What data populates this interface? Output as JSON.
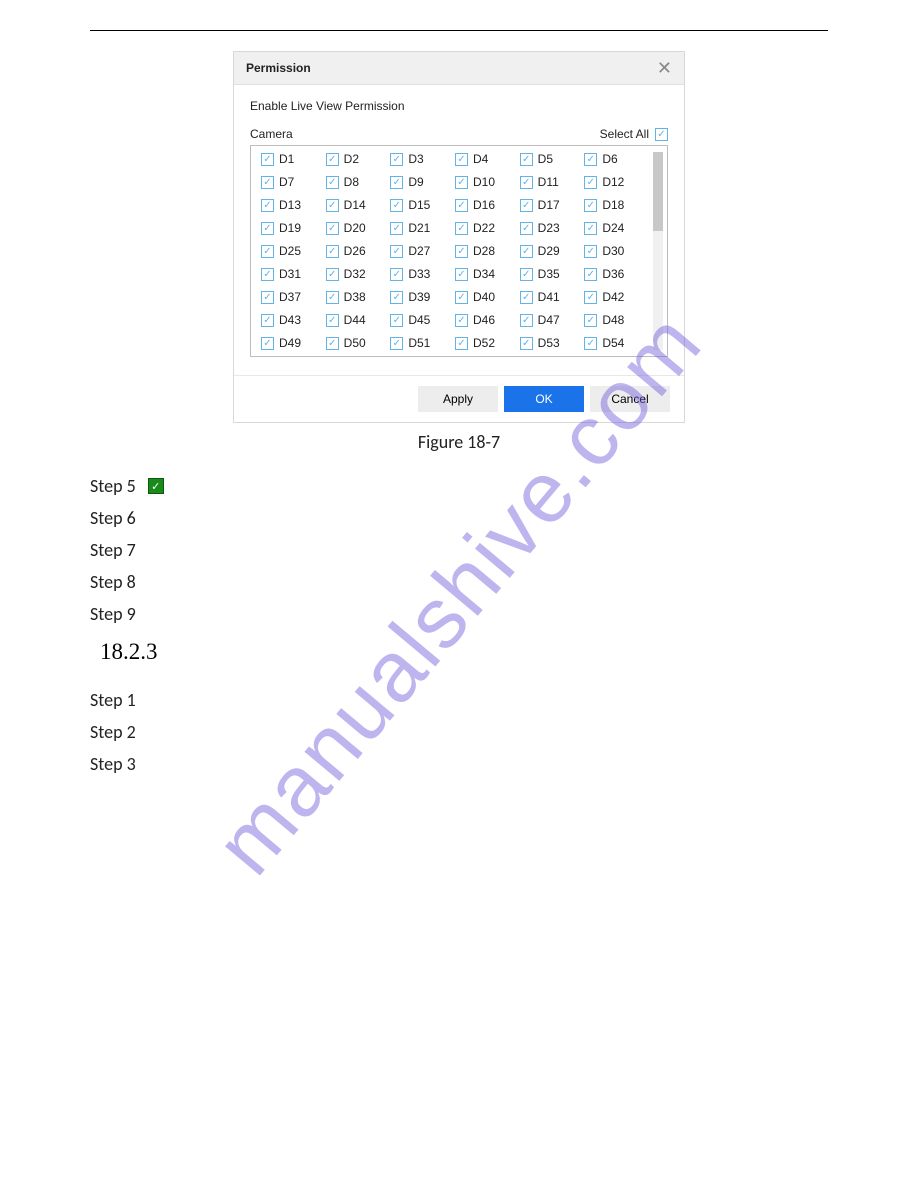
{
  "dialog": {
    "title": "Permission",
    "subtitle": "Enable Live View Permission",
    "cameraLabel": "Camera",
    "selectAllLabel": "Select All",
    "selectAllChecked": true,
    "cameras": [
      {
        "label": "D1",
        "checked": true
      },
      {
        "label": "D2",
        "checked": true
      },
      {
        "label": "D3",
        "checked": true
      },
      {
        "label": "D4",
        "checked": true
      },
      {
        "label": "D5",
        "checked": true
      },
      {
        "label": "D6",
        "checked": true
      },
      {
        "label": "D7",
        "checked": true
      },
      {
        "label": "D8",
        "checked": true
      },
      {
        "label": "D9",
        "checked": true
      },
      {
        "label": "D10",
        "checked": true
      },
      {
        "label": "D11",
        "checked": true
      },
      {
        "label": "D12",
        "checked": true
      },
      {
        "label": "D13",
        "checked": true
      },
      {
        "label": "D14",
        "checked": true
      },
      {
        "label": "D15",
        "checked": true
      },
      {
        "label": "D16",
        "checked": true
      },
      {
        "label": "D17",
        "checked": true
      },
      {
        "label": "D18",
        "checked": true
      },
      {
        "label": "D19",
        "checked": true
      },
      {
        "label": "D20",
        "checked": true
      },
      {
        "label": "D21",
        "checked": true
      },
      {
        "label": "D22",
        "checked": true
      },
      {
        "label": "D23",
        "checked": true
      },
      {
        "label": "D24",
        "checked": true
      },
      {
        "label": "D25",
        "checked": true
      },
      {
        "label": "D26",
        "checked": true
      },
      {
        "label": "D27",
        "checked": true
      },
      {
        "label": "D28",
        "checked": true
      },
      {
        "label": "D29",
        "checked": true
      },
      {
        "label": "D30",
        "checked": true
      },
      {
        "label": "D31",
        "checked": true
      },
      {
        "label": "D32",
        "checked": true
      },
      {
        "label": "D33",
        "checked": true
      },
      {
        "label": "D34",
        "checked": true
      },
      {
        "label": "D35",
        "checked": true
      },
      {
        "label": "D36",
        "checked": true
      },
      {
        "label": "D37",
        "checked": true
      },
      {
        "label": "D38",
        "checked": true
      },
      {
        "label": "D39",
        "checked": true
      },
      {
        "label": "D40",
        "checked": true
      },
      {
        "label": "D41",
        "checked": true
      },
      {
        "label": "D42",
        "checked": true
      },
      {
        "label": "D43",
        "checked": true
      },
      {
        "label": "D44",
        "checked": true
      },
      {
        "label": "D45",
        "checked": true
      },
      {
        "label": "D46",
        "checked": true
      },
      {
        "label": "D47",
        "checked": true
      },
      {
        "label": "D48",
        "checked": true
      },
      {
        "label": "D49",
        "checked": true
      },
      {
        "label": "D50",
        "checked": true
      },
      {
        "label": "D51",
        "checked": true
      },
      {
        "label": "D52",
        "checked": true
      },
      {
        "label": "D53",
        "checked": true
      },
      {
        "label": "D54",
        "checked": true
      }
    ],
    "buttons": {
      "apply": "Apply",
      "ok": "OK",
      "cancel": "Cancel"
    }
  },
  "figureCaption": "Figure 18-7",
  "stepsA": [
    "Step 5",
    "Step 6",
    "Step 7",
    "Step 8",
    "Step 9"
  ],
  "sectionNumber": "18.2.3",
  "stepsB": [
    "Step 1",
    "Step 2",
    "Step 3"
  ],
  "watermark": "manualshive.com"
}
